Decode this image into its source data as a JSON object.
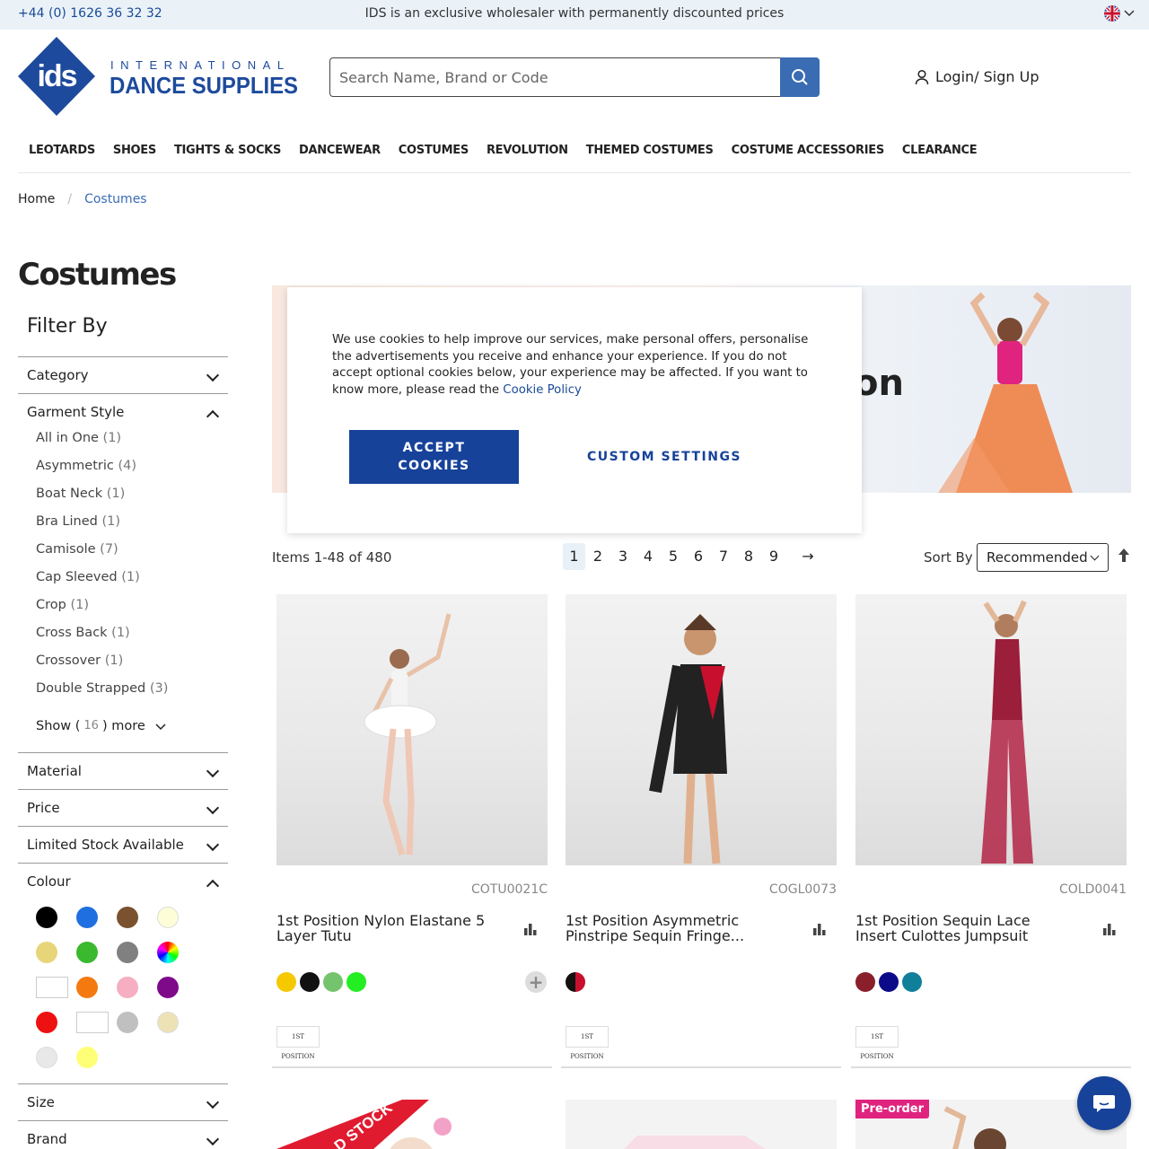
{
  "topbar": {
    "phone": "+44 (0) 1626 36 32 32",
    "promo": "IDS is an exclusive wholesaler with permanently discounted prices"
  },
  "header": {
    "logo_text_top": "INTERNATIONAL",
    "logo_text_bottom": "DANCE SUPPLIES",
    "logo_mark": "ids",
    "search_placeholder": "Search Name, Brand or Code",
    "login_label": "Login/ Sign Up"
  },
  "nav": [
    "LEOTARDS",
    "SHOES",
    "TIGHTS & SOCKS",
    "DANCEWEAR",
    "COSTUMES",
    "REVOLUTION",
    "THEMED COSTUMES",
    "COSTUME ACCESSORIES",
    "CLEARANCE"
  ],
  "breadcrumb": {
    "home": "Home",
    "sep": "/",
    "current": "Costumes"
  },
  "page_title": "Costumes",
  "filters": {
    "title": "Filter By",
    "category": "Category",
    "garment_style": {
      "label": "Garment Style",
      "options": [
        {
          "name": "All in One",
          "count": "(1)"
        },
        {
          "name": "Asymmetric",
          "count": "(4)"
        },
        {
          "name": "Boat Neck",
          "count": "(1)"
        },
        {
          "name": "Bra Lined",
          "count": "(1)"
        },
        {
          "name": "Camisole",
          "count": "(7)"
        },
        {
          "name": "Cap Sleeved",
          "count": "(1)"
        },
        {
          "name": "Crop",
          "count": "(1)"
        },
        {
          "name": "Cross Back",
          "count": "(1)"
        },
        {
          "name": "Crossover",
          "count": "(1)"
        },
        {
          "name": "Double Strapped",
          "count": "(3)"
        }
      ],
      "show_more": {
        "prefix": "Show (",
        "count": "16",
        "suffix": ") more"
      }
    },
    "material": "Material",
    "price": "Price",
    "limited_stock": "Limited Stock Available",
    "colour": {
      "label": "Colour",
      "swatches": [
        "#000000",
        "#1f6fe0",
        "#7a5230",
        "#fdfdd8",
        "#e8d57a",
        "#3ab82e",
        "#808080",
        "gradient",
        "#ffffff",
        "#f47a10",
        "#f6aec2",
        "#7e0a8a",
        "#ee1111",
        "#ffffff",
        "#c0c0c0",
        "#ede2b5",
        "#e8e8e8",
        "#ffff77"
      ]
    },
    "size": "Size",
    "brand": "Brand"
  },
  "banner": {
    "word": "on"
  },
  "cookie": {
    "text": "We use cookies to help improve our services, make personal offers, personalise the advertisements you receive and enhance your experience. If you do not accept optional cookies below, your experience may be affected. If you want to know more, please read the ",
    "link": "Cookie Policy",
    "accept_line1": "ACCEPT",
    "accept_line2": "COOKIES",
    "custom": "CUSTOM SETTINGS"
  },
  "toolbar": {
    "items": "Items 1-48 of 480",
    "pages": [
      "1",
      "2",
      "3",
      "4",
      "5",
      "6",
      "7",
      "8",
      "9"
    ],
    "active_page": "1",
    "next": "→",
    "sort_label": "Sort By",
    "sort_value": "Recommended"
  },
  "products": [
    {
      "code": "COTU0021C",
      "name": "1st Position Nylon Elastane 5 Layer Tutu",
      "colors": [
        "#f5c800",
        "#111111",
        "#74c46d",
        "#22ee22"
      ],
      "more": "+",
      "brand": "1ST POSITION"
    },
    {
      "code": "COGL0073",
      "name": "1st Position Asymmetric Pinstripe Sequin Fringe...",
      "colors": [
        "split"
      ],
      "brand": "1ST POSITION"
    },
    {
      "code": "COLD0041",
      "name": "1st Position Sequin Lace Insert Culottes Jumpsuit",
      "colors": [
        "#8a1f2b",
        "#0d0a8a",
        "#0f7f9a"
      ],
      "brand": "1ST POSITION"
    }
  ],
  "row2": {
    "ribbon": "D STOCK",
    "preorder": "Pre-order"
  }
}
